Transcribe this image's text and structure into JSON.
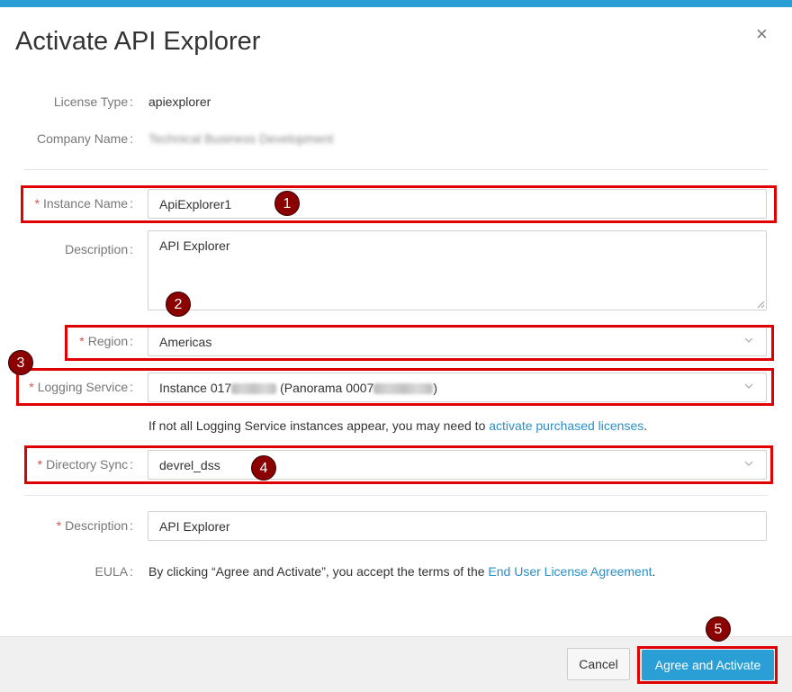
{
  "dialog": {
    "title": "Activate API Explorer",
    "close_icon": "×"
  },
  "fields": {
    "license_type": {
      "label": "License Type",
      "value": "apiexplorer"
    },
    "company_name": {
      "label": "Company Name",
      "value": "Technical Business Development"
    },
    "instance_name": {
      "label": "Instance Name",
      "value": "ApiExplorer1"
    },
    "description": {
      "label": "Description",
      "value": "API Explorer"
    },
    "region": {
      "label": "Region",
      "value": "Americas"
    },
    "logging_service": {
      "label": "Logging Service",
      "value_prefix": "Instance 017",
      "value_middle": "(Panorama 0007",
      "value_suffix": ")"
    },
    "directory_sync": {
      "label": "Directory Sync",
      "value": "devrel_dss"
    },
    "description2": {
      "label": "Description",
      "value": "API Explorer"
    },
    "eula": {
      "label": "EULA",
      "text_before": "By clicking “Agree and Activate”, you accept the terms of the",
      "link": "End User License Agreement",
      "text_after": "."
    }
  },
  "note": {
    "text_before": "If not all Logging Service instances appear, you may need to",
    "link": "activate purchased licenses",
    "text_after": "."
  },
  "footer": {
    "cancel_label": "Cancel",
    "agree_label": "Agree and Activate"
  },
  "annotations": [
    "1",
    "2",
    "3",
    "4",
    "5"
  ],
  "colors": {
    "accent": "#2a9fd6",
    "annotation_box": "#e00000",
    "annotation_badge": "#8b0000",
    "required": "#d9534f",
    "link": "#2a8fc8"
  }
}
